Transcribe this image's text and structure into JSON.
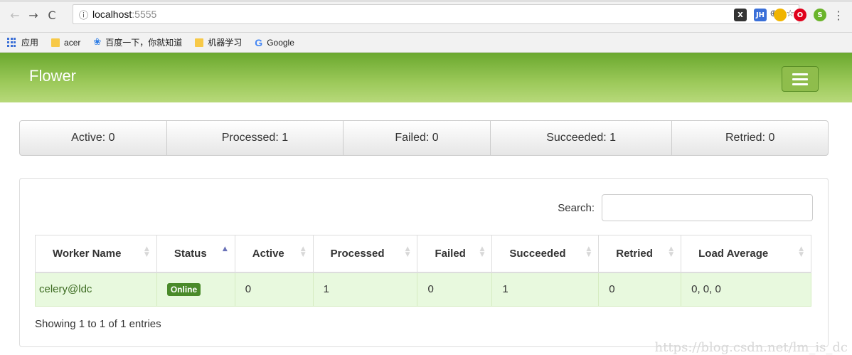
{
  "browser": {
    "url_host": "localhost",
    "url_port": ":5555",
    "bookmarks": [
      {
        "label": "应用",
        "icon": "apps-icon"
      },
      {
        "label": "acer",
        "icon": "folder-icon"
      },
      {
        "label": "百度一下，你就知道",
        "icon": "baidu-paw-icon"
      },
      {
        "label": "机器学习",
        "icon": "folder-icon"
      },
      {
        "label": "Google",
        "icon": "google-icon"
      }
    ],
    "extensions": [
      {
        "label": "X",
        "color": "#333333"
      },
      {
        "label": "JH",
        "color": "#3a6fd8"
      },
      {
        "label": "",
        "color": "#f0b400"
      },
      {
        "label": "O",
        "color": "#e0001b"
      },
      {
        "label": "S",
        "color": "#6ab42a"
      }
    ]
  },
  "navbar": {
    "brand": "Flower",
    "colors": {
      "top": "#6aa82e",
      "bottom": "#b7d97a"
    }
  },
  "stats": [
    {
      "label": "Active: 0"
    },
    {
      "label": "Processed: 1"
    },
    {
      "label": "Failed: 0"
    },
    {
      "label": "Succeeded: 1"
    },
    {
      "label": "Retried: 0"
    }
  ],
  "table": {
    "search_label": "Search:",
    "search_value": "",
    "columns": [
      "Worker Name",
      "Status",
      "Active",
      "Processed",
      "Failed",
      "Succeeded",
      "Retried",
      "Load Average"
    ],
    "sorted_column": "Status",
    "sort_direction": "ascending",
    "rows": [
      {
        "worker_name": "celery@ldc",
        "status": "Online",
        "active": "0",
        "processed": "1",
        "failed": "0",
        "succeeded": "1",
        "retried": "0",
        "load_average": "0, 0, 0"
      }
    ],
    "info": "Showing 1 to 1 of 1 entries"
  },
  "watermark": "https://blog.csdn.net/lm_is_dc"
}
